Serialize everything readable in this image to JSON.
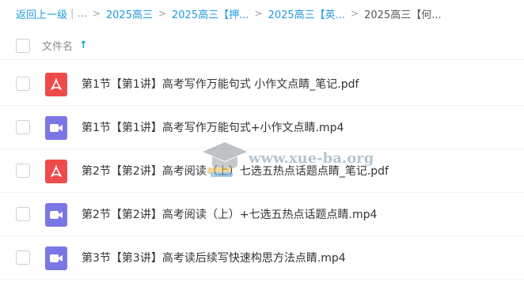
{
  "breadcrumb": {
    "back_label": "返回上一级",
    "separator": "|",
    "ellipsis": "...",
    "arrow": ">",
    "items": [
      "2025高三",
      "2025高三【押...",
      "2025高三【英...",
      "2025高三【何..."
    ]
  },
  "header": {
    "column_label": "文件名",
    "sort_icon": "↑"
  },
  "files": [
    {
      "name": "第1节【第1讲】高考写作万能句式 小作文点睛_笔记.pdf",
      "type": "pdf"
    },
    {
      "name": "第1节【第1讲】高考写作万能句式+小作文点睛.mp4",
      "type": "video"
    },
    {
      "name": "第2节【第2讲】高考阅读（上）七选五热点话题点睛_笔记.pdf",
      "type": "pdf"
    },
    {
      "name": "第2节【第2讲】高考阅读（上）+七选五热点话题点睛.mp4",
      "type": "video"
    },
    {
      "name": "第3节【第3讲】高考读后续写快速构思方法点睛.mp4",
      "type": "video"
    }
  ],
  "watermark": {
    "text": "www.xue-ba.org",
    "icon": "graduation-cap-icon"
  },
  "colors": {
    "link": "#1e9ae0",
    "pdf_icon": "#ee4b4b",
    "video_icon": "#7b76e6"
  }
}
